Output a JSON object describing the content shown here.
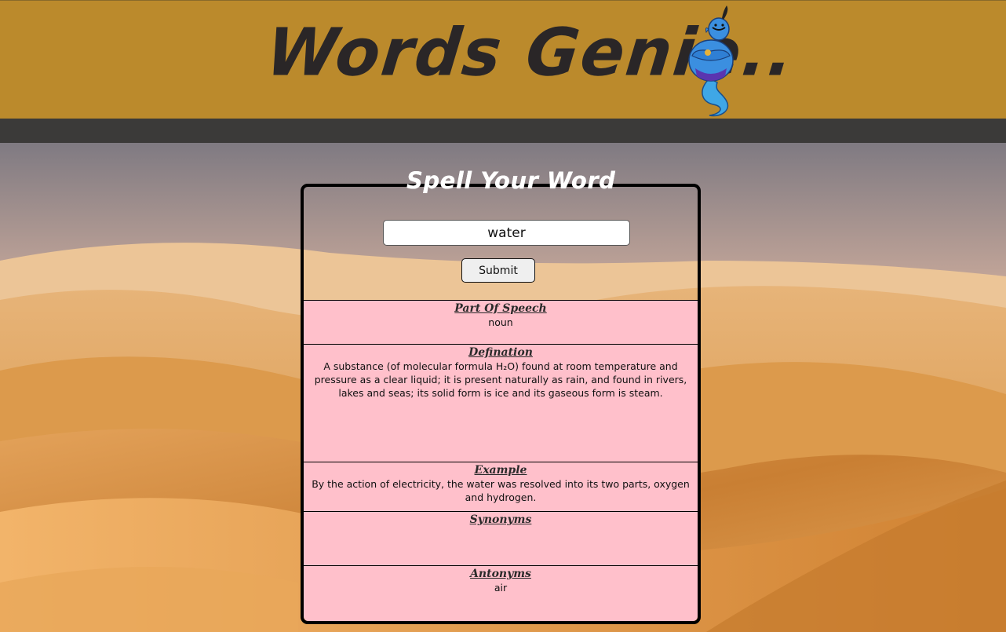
{
  "header": {
    "title": "Words Genie.."
  },
  "form": {
    "legend": "Spell Your Word",
    "input_value": "water",
    "submit_label": "Submit"
  },
  "results": {
    "part_of_speech": {
      "heading": "Part Of Speech",
      "value": "noun"
    },
    "definition": {
      "heading": "Defination",
      "value": "A substance (of molecular formula H₂O) found at room temperature and pressure as a clear liquid; it is present naturally as rain, and found in rivers, lakes and seas; its solid form is ice and its gaseous form is steam."
    },
    "example": {
      "heading": "Example",
      "value": "By the action of electricity, the water was resolved into its two parts, oxygen and hydrogen."
    },
    "synonyms": {
      "heading": "Synonyms",
      "value": ""
    },
    "antonyms": {
      "heading": "Antonyms",
      "value": "air"
    }
  },
  "icons": {
    "logo": "genie-icon"
  },
  "colors": {
    "header_bg": "#bb8a2c",
    "nav_bg": "#3b3a39",
    "results_bg": "#ffc0cb",
    "title_color": "#2a2627"
  }
}
